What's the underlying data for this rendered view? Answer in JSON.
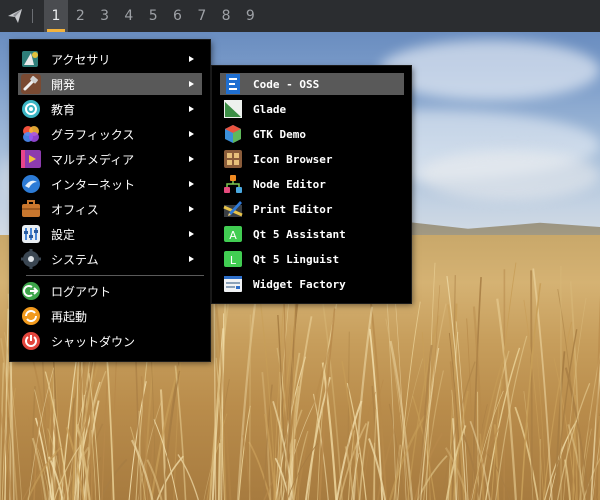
{
  "panel": {
    "launcher_icon": "paper-plane-icon",
    "workspaces": [
      "1",
      "2",
      "3",
      "4",
      "5",
      "6",
      "7",
      "8",
      "9"
    ],
    "active_workspace": "1",
    "accent_color": "#f3b33d"
  },
  "main_menu": {
    "items": [
      {
        "label": "アクセサリ",
        "icon": "accessories-icon",
        "submenu": true
      },
      {
        "label": "開発",
        "icon": "development-icon",
        "submenu": true
      },
      {
        "label": "教育",
        "icon": "education-icon",
        "submenu": true
      },
      {
        "label": "グラフィックス",
        "icon": "graphics-icon",
        "submenu": true
      },
      {
        "label": "マルチメディア",
        "icon": "multimedia-icon",
        "submenu": true
      },
      {
        "label": "インターネット",
        "icon": "internet-icon",
        "submenu": true
      },
      {
        "label": "オフィス",
        "icon": "office-icon",
        "submenu": true
      },
      {
        "label": "設定",
        "icon": "settings-icon",
        "submenu": true
      },
      {
        "label": "システム",
        "icon": "system-icon",
        "submenu": true
      }
    ],
    "highlighted": "開発",
    "session": [
      {
        "label": "ログアウト",
        "icon": "logout-icon"
      },
      {
        "label": "再起動",
        "icon": "reboot-icon"
      },
      {
        "label": "シャットダウン",
        "icon": "shutdown-icon"
      }
    ]
  },
  "sub_menu": {
    "items": [
      {
        "label": "Code - OSS",
        "icon": "code-oss-icon"
      },
      {
        "label": "Glade",
        "icon": "glade-icon"
      },
      {
        "label": "GTK Demo",
        "icon": "gtk-demo-icon"
      },
      {
        "label": "Icon Browser",
        "icon": "icon-browser-icon"
      },
      {
        "label": "Node Editor",
        "icon": "node-editor-icon"
      },
      {
        "label": "Print Editor",
        "icon": "print-editor-icon"
      },
      {
        "label": "Qt 5 Assistant",
        "icon": "qt-assistant-icon"
      },
      {
        "label": "Qt 5 Linguist",
        "icon": "qt-linguist-icon"
      },
      {
        "label": "Widget Factory",
        "icon": "widget-factory-icon"
      }
    ],
    "highlighted": "Code - OSS"
  }
}
